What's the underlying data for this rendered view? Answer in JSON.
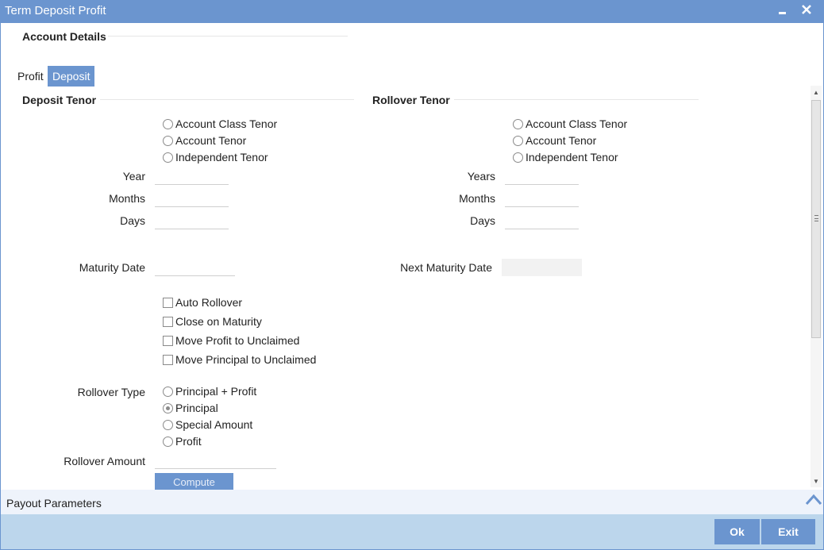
{
  "window": {
    "title": "Term Deposit Profit"
  },
  "account_details": {
    "heading": "Account Details"
  },
  "tabs": [
    {
      "label": "Profit",
      "active": false
    },
    {
      "label": "Deposit",
      "active": true
    }
  ],
  "deposit_tenor": {
    "heading": "Deposit Tenor",
    "options": [
      "Account Class Tenor",
      "Account Tenor",
      "Independent Tenor"
    ],
    "year_label": "Year",
    "months_label": "Months",
    "days_label": "Days",
    "year_value": "",
    "months_value": "",
    "days_value": "",
    "maturity_label": "Maturity Date",
    "maturity_value": ""
  },
  "rollover_tenor": {
    "heading": "Rollover Tenor",
    "options": [
      "Account Class Tenor",
      "Account Tenor",
      "Independent Tenor"
    ],
    "years_label": "Years",
    "months_label": "Months",
    "days_label": "Days",
    "years_value": "",
    "months_value": "",
    "days_value": "",
    "next_maturity_label": "Next Maturity Date",
    "next_maturity_value": ""
  },
  "checkboxes": [
    "Auto Rollover",
    "Close on Maturity",
    "Move Profit to Unclaimed",
    "Move Principal to Unclaimed"
  ],
  "rollover_type": {
    "label": "Rollover Type",
    "options": [
      "Principal + Profit",
      "Principal",
      "Special Amount",
      "Profit"
    ],
    "selected": "Principal"
  },
  "rollover_amount": {
    "label": "Rollover Amount",
    "value": ""
  },
  "compute_label": "Compute",
  "payout": {
    "label": "Payout Parameters"
  },
  "footer": {
    "ok": "Ok",
    "exit": "Exit"
  },
  "colors": {
    "accent": "#6b95cf",
    "footer_bg": "#bcd6ec",
    "payout_bg": "#eef3fb"
  }
}
